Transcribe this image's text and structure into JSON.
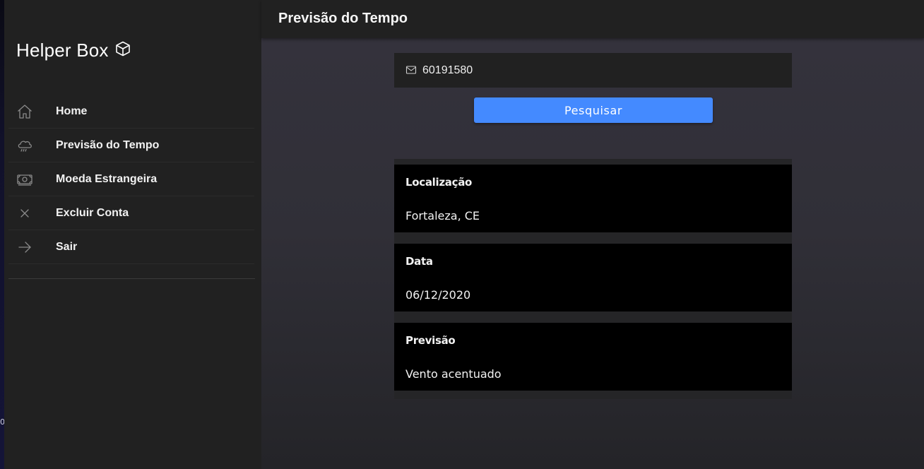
{
  "app": {
    "name": "Helper Box",
    "brand_icon": "cube-icon"
  },
  "edge": {
    "glyph": "0"
  },
  "sidebar": {
    "items": [
      {
        "label": "Home",
        "icon": "home-icon"
      },
      {
        "label": "Previsão do Tempo",
        "icon": "rain-cloud-icon"
      },
      {
        "label": "Moeda Estrangeira",
        "icon": "money-icon"
      },
      {
        "label": "Excluir Conta",
        "icon": "close-icon"
      },
      {
        "label": "Sair",
        "icon": "arrow-right-icon"
      }
    ]
  },
  "header": {
    "title": "Previsão do Tempo"
  },
  "search": {
    "cep_value": "60191580",
    "icon": "mail-icon",
    "button_label": "Pesquisar"
  },
  "results": [
    {
      "title": "Localização",
      "value": "Fortaleza, CE"
    },
    {
      "title": "Data",
      "value": "06/12/2020"
    },
    {
      "title": "Previsão",
      "value": "Vento acentuado"
    }
  ],
  "colors": {
    "accent": "#448aff",
    "sidebar_bg": "#212121",
    "card_bg": "#000000"
  }
}
